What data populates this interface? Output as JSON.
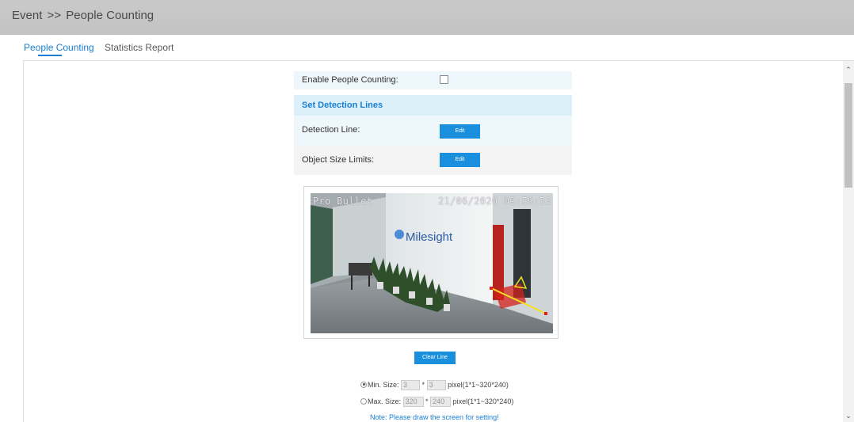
{
  "header": {
    "section": "Event",
    "separator": ">>",
    "page": "People Counting"
  },
  "tabs": [
    {
      "label": "People Counting",
      "active": true
    },
    {
      "label": "Statistics Report",
      "active": false
    }
  ],
  "settings": {
    "enable_label": "Enable People Counting:",
    "enable_checked": false,
    "section_title": "Set Detection Lines",
    "detection_line_label": "Detection Line:",
    "detection_line_button": "Edit",
    "object_size_label": "Object Size Limits:",
    "object_size_button": "Edit"
  },
  "video": {
    "osd_name": "Pro Bullet",
    "osd_datetime": "21/06/2020 09:59:53",
    "brand_text": "Milesight"
  },
  "clear_button": "Clear Line",
  "min_size": {
    "label": "Min. Size:",
    "width": "3",
    "times": "*",
    "height": "3",
    "hint": "pixel(1*1~320*240)",
    "selected": true
  },
  "max_size": {
    "label": "Max. Size:",
    "width": "320",
    "times": "*",
    "height": "240",
    "hint": "pixel(1*1~320*240)",
    "selected": false
  },
  "note": "Note: Please draw the screen for setting!",
  "colors": {
    "accent": "#1a7fd4",
    "button": "#1a8fdd",
    "header_bg": "#c6c6c6",
    "section_bg": "#dcf0f9",
    "detection_region": "#d4221c",
    "detection_line": "#f2e21c"
  }
}
